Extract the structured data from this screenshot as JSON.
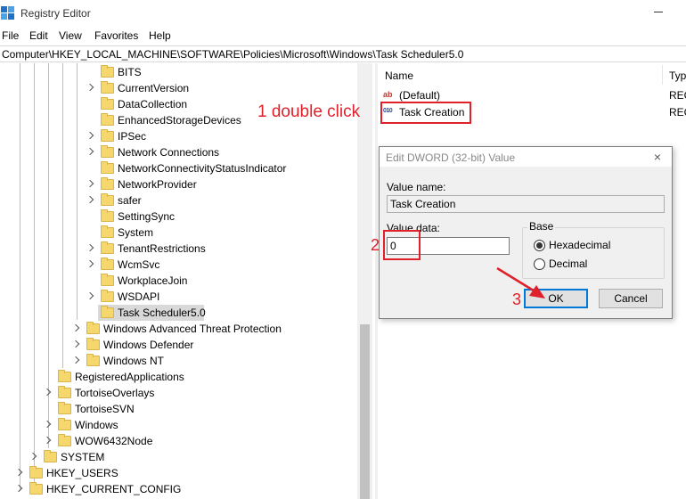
{
  "window": {
    "title": "Registry Editor"
  },
  "menu": [
    "File",
    "Edit",
    "View",
    "Favorites",
    "Help"
  ],
  "address": "Computer\\HKEY_LOCAL_MACHINE\\SOFTWARE\\Policies\\Microsoft\\Windows\\Task Scheduler5.0",
  "tree": {
    "items": [
      {
        "label": "BITS",
        "expander": false
      },
      {
        "label": "CurrentVersion",
        "expander": true
      },
      {
        "label": "DataCollection",
        "expander": false
      },
      {
        "label": "EnhancedStorageDevices",
        "expander": false
      },
      {
        "label": "IPSec",
        "expander": true
      },
      {
        "label": "Network Connections",
        "expander": true
      },
      {
        "label": "NetworkConnectivityStatusIndicator",
        "expander": false
      },
      {
        "label": "NetworkProvider",
        "expander": true
      },
      {
        "label": "safer",
        "expander": true
      },
      {
        "label": "SettingSync",
        "expander": false
      },
      {
        "label": "System",
        "expander": false
      },
      {
        "label": "TenantRestrictions",
        "expander": true
      },
      {
        "label": "WcmSvc",
        "expander": true
      },
      {
        "label": "WorkplaceJoin",
        "expander": false
      },
      {
        "label": "WSDAPI",
        "expander": true
      },
      {
        "label": "Task Scheduler5.0",
        "expander": false,
        "selected": true
      },
      {
        "label": "Windows Advanced Threat Protection",
        "expander": true
      },
      {
        "label": "Windows Defender",
        "expander": true
      },
      {
        "label": "Windows NT",
        "expander": true
      },
      {
        "label": "RegisteredApplications",
        "expander": false
      },
      {
        "label": "TortoiseOverlays",
        "expander": true
      },
      {
        "label": "TortoiseSVN",
        "expander": false
      },
      {
        "label": "Windows",
        "expander": true
      },
      {
        "label": "WOW6432Node",
        "expander": true
      },
      {
        "label": "SYSTEM",
        "expander": true
      },
      {
        "label": "HKEY_USERS",
        "expander": true
      },
      {
        "label": "HKEY_CURRENT_CONFIG",
        "expander": true
      }
    ]
  },
  "list": {
    "columns": {
      "name": "Name",
      "type": "Typ"
    },
    "rows": [
      {
        "icon": "ab",
        "name": "(Default)",
        "type": "REG"
      },
      {
        "icon": "010",
        "name": "Task Creation",
        "type": "REG"
      }
    ]
  },
  "dialog": {
    "title": "Edit DWORD (32-bit) Value",
    "close": "×",
    "value_name_label": "Value name:",
    "value_name": "Task Creation",
    "value_data_label": "Value data:",
    "value_data": "0",
    "base_label": "Base",
    "hex_label": "Hexadecimal",
    "dec_label": "Decimal",
    "base_selected": "Hexadecimal",
    "ok_label": "OK",
    "cancel_label": "Cancel"
  },
  "annotations": {
    "step1": "1 double click",
    "step2": "2",
    "step3": "3",
    "color": "#e0202a"
  },
  "colors": {
    "accent": "#0078d7",
    "folder": "#f5d76e",
    "selection": "#d9d9d9"
  }
}
